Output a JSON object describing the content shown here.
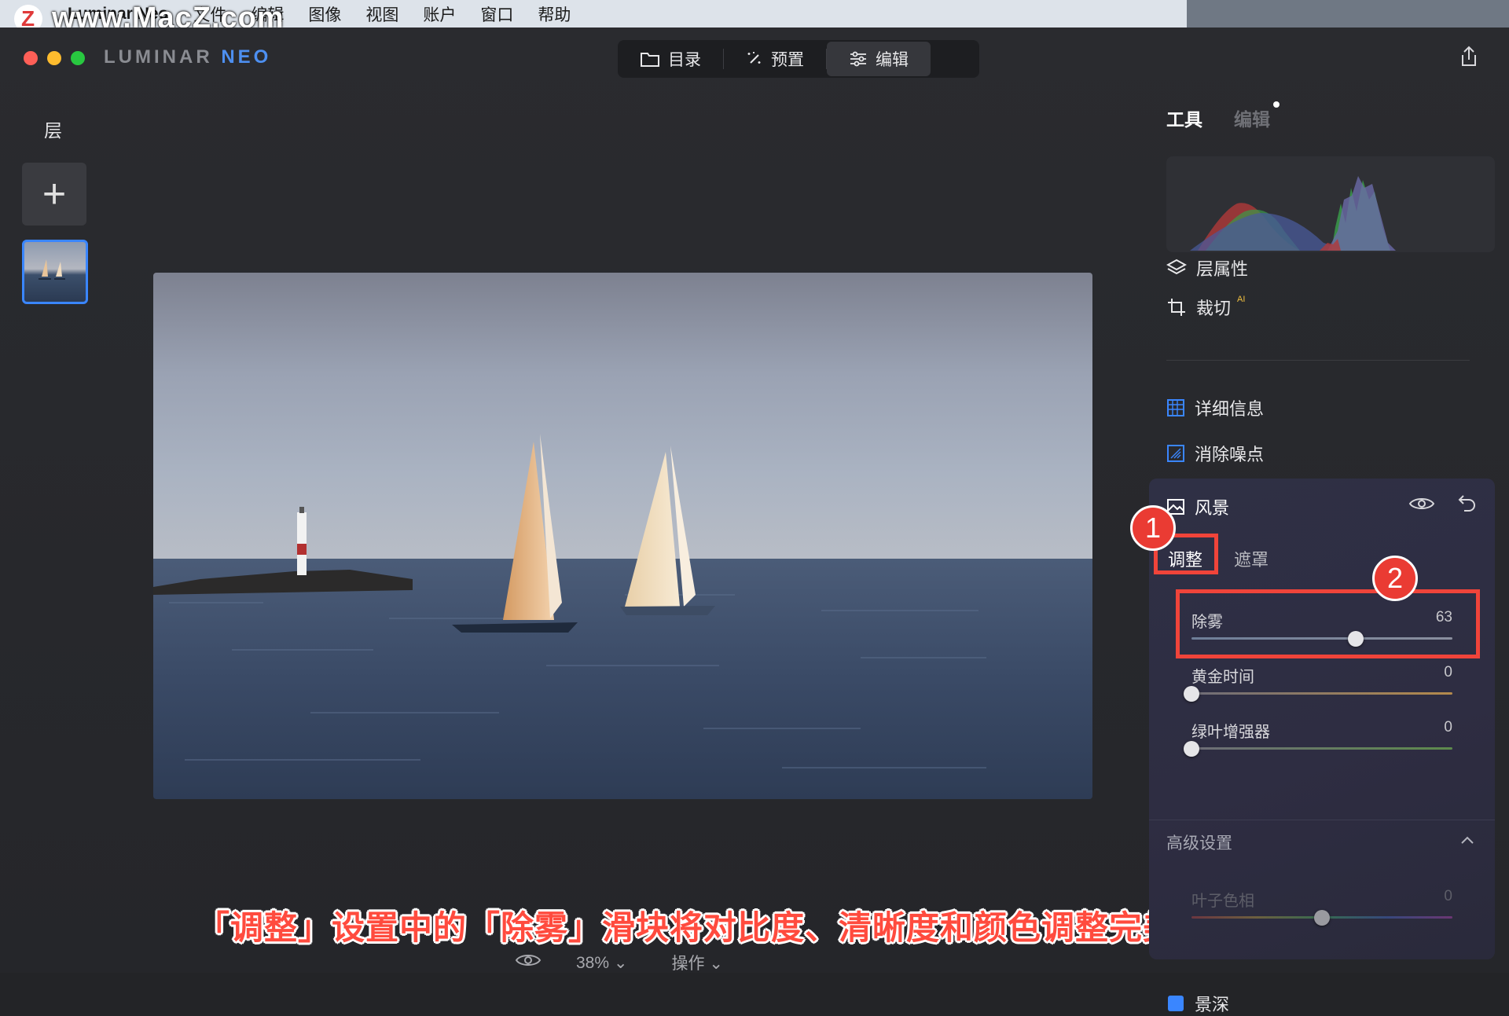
{
  "menubar": {
    "app_name": "Luminar Neo",
    "items": [
      "文件",
      "编辑",
      "图像",
      "视图",
      "账户",
      "窗口",
      "帮助"
    ]
  },
  "watermark": {
    "logo_letter": "Z",
    "text": "www.MacZ.com"
  },
  "window": {
    "logo_main": "LUMINAR ",
    "logo_accent": "NEO",
    "nav": {
      "catalog": "目录",
      "presets": "预置",
      "edit": "编辑"
    }
  },
  "left_panel": {
    "title": "层",
    "add_label": "+"
  },
  "right_panel": {
    "tab_tools": "工具",
    "tab_edits": "编辑",
    "tools": {
      "layer_properties": "层属性",
      "crop": "裁切",
      "crop_badge": "AI",
      "details": "详细信息",
      "denoise": "消除噪点"
    },
    "landscape": {
      "title": "风景",
      "tab_adjust": "调整",
      "tab_mask": "遮罩",
      "sliders": [
        {
          "label": "除雾",
          "value": 63,
          "display": "63"
        },
        {
          "label": "黄金时间",
          "value": 0,
          "display": "0"
        },
        {
          "label": "绿叶增强器",
          "value": 0,
          "display": "0"
        }
      ],
      "advanced": "高级设置",
      "advanced_sliders": [
        {
          "label": "叶子色相",
          "value": 0,
          "display": "0"
        }
      ]
    },
    "next_tool": "景深"
  },
  "bottom_bar": {
    "zoom": "38%",
    "actions": "操作"
  },
  "annotations": {
    "caption": "「调整」设置中的「除雾」滑块将对比度、清晰度和颜色调整完美融合",
    "badge_1": "1",
    "badge_2": "2"
  },
  "colors": {
    "accent": "#3a86ff",
    "annotation_red": "#ea3b33",
    "panel_bg": "#2f3045",
    "window_bg": "#25262a"
  }
}
